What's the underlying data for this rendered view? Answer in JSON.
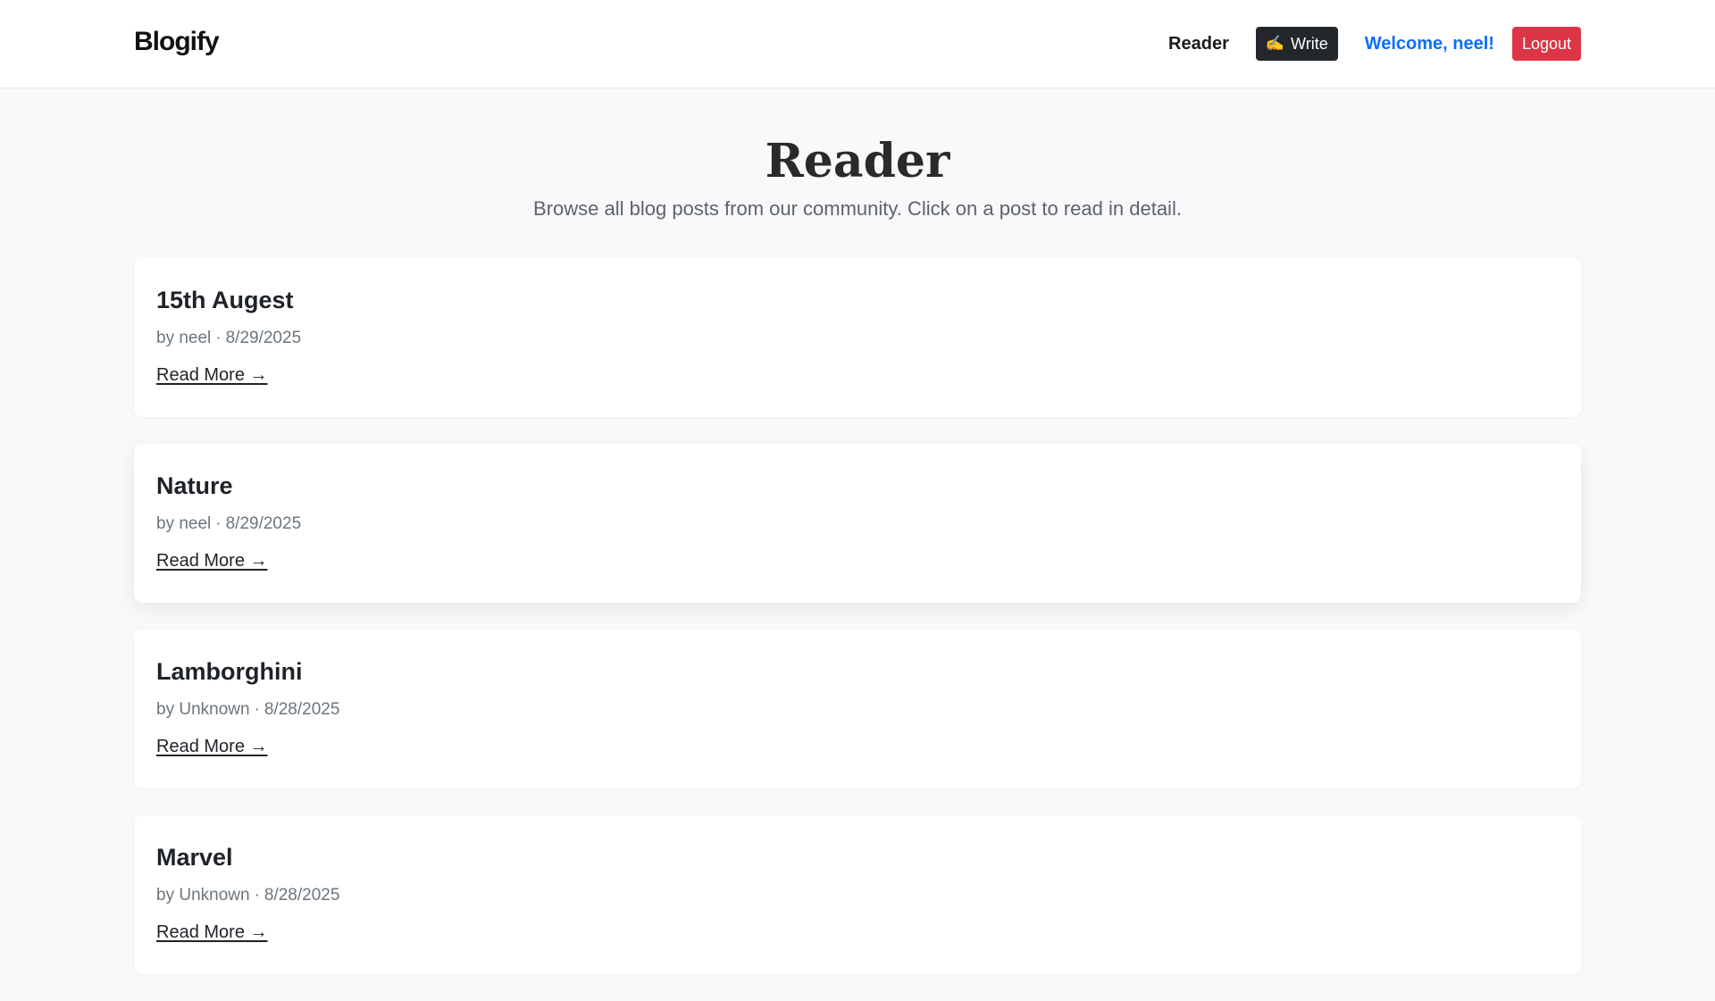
{
  "header": {
    "brand": "Blogify",
    "nav_reader": "Reader",
    "write_label": "Write",
    "write_icon": "writing-hand-icon",
    "welcome": "Welcome, neel!",
    "logout_label": "Logout"
  },
  "page": {
    "title": "Reader",
    "subtitle": "Browse all blog posts from our community. Click on a post to read in detail."
  },
  "posts": [
    {
      "title": "15th Augest",
      "author": "by neel",
      "date": "8/29/2025",
      "link": "Read More →"
    },
    {
      "title": "Nature",
      "author": "by neel",
      "date": "8/29/2025",
      "link": "Read More →"
    },
    {
      "title": "Lamborghini",
      "author": "by Unknown",
      "date": "8/28/2025",
      "link": "Read More →"
    },
    {
      "title": "Marvel",
      "author": "by Unknown",
      "date": "8/28/2025",
      "link": "Read More →"
    }
  ],
  "colors": {
    "welcome": "#0d6efd",
    "logout_bg": "#dc3545",
    "write_bg": "#23272b",
    "page_bg": "#f8f9fb"
  }
}
